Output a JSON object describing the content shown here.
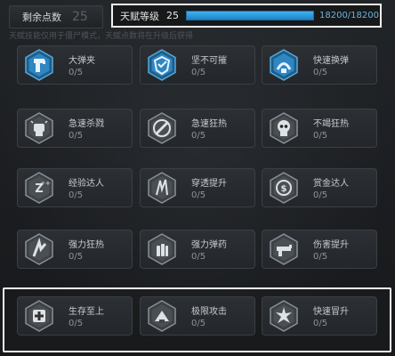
{
  "header": {
    "points_label": "剩余点数",
    "points_value": "25",
    "level_label": "天赋等级",
    "level_value": "25",
    "level_progress": 1.0,
    "level_text": "18200/18200",
    "notice": "天赋技能仅用于僵尸模式，天赋点数将在升级后获得"
  },
  "talents": [
    {
      "name": "大弹夹",
      "count": "0/5",
      "icon": "magazine-icon",
      "color": "blue"
    },
    {
      "name": "坚不可摧",
      "count": "0/5",
      "icon": "shield-icon",
      "color": "blue"
    },
    {
      "name": "快速换弹",
      "count": "0/5",
      "icon": "reload-icon",
      "color": "blue"
    },
    {
      "name": "急速杀戮",
      "count": "0/5",
      "icon": "fist-icon",
      "color": "gray"
    },
    {
      "name": "急速狂热",
      "count": "0/5",
      "icon": "fury-icon",
      "color": "gray"
    },
    {
      "name": "不竭狂热",
      "count": "0/5",
      "icon": "skull-icon",
      "color": "gray"
    },
    {
      "name": "经验达人",
      "count": "0/5",
      "icon": "experience-icon",
      "color": "gray"
    },
    {
      "name": "穿透提升",
      "count": "0/5",
      "icon": "penetration-icon",
      "color": "gray"
    },
    {
      "name": "赏金达人",
      "count": "0/5",
      "icon": "bounty-icon",
      "color": "gray"
    },
    {
      "name": "强力狂热",
      "count": "0/5",
      "icon": "power-fury-icon",
      "color": "gray"
    },
    {
      "name": "强力弹药",
      "count": "0/5",
      "icon": "ammo-icon",
      "color": "gray"
    },
    {
      "name": "伤害提升",
      "count": "0/5",
      "icon": "damage-icon",
      "color": "gray"
    },
    {
      "name": "生存至上",
      "count": "0/5",
      "icon": "medkit-icon",
      "color": "gray"
    },
    {
      "name": "极限攻击",
      "count": "0/5",
      "icon": "attack-icon",
      "color": "gray"
    },
    {
      "name": "快速冒升",
      "count": "0/5",
      "icon": "burst-icon",
      "color": "gray"
    }
  ]
}
